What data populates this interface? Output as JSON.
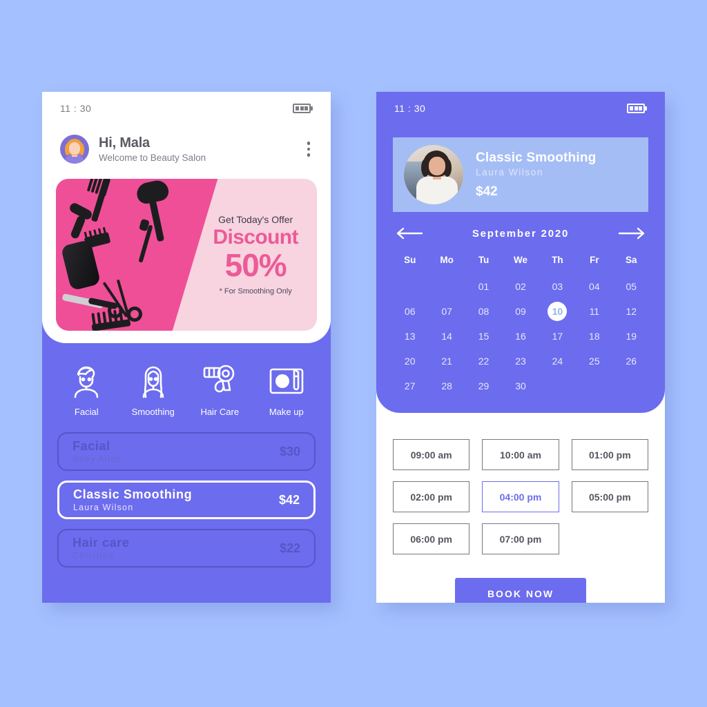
{
  "page": {
    "background_color": "#a5c0fe",
    "accent_purple": "#6c6cee",
    "accent_pink": "#ec5a97",
    "card_blue": "#a5bdf5"
  },
  "left_phone": {
    "status_bar": {
      "time": "11 : 30",
      "signal_icon": "signal-bars-icon",
      "battery_icon": "battery-icon"
    },
    "header": {
      "avatar_icon": "user-avatar-icon",
      "greeting": "Hi, Mala",
      "subtitle": "Welcome to Beauty Salon",
      "menu_icon": "kebab-menu-icon"
    },
    "banner": {
      "offer_label": "Get Today's Offer",
      "discount_word": "Discount",
      "discount_value": "50%",
      "note": "* For Smoothing Only"
    },
    "categories": [
      {
        "label": "Facial",
        "icon": "facial-icon"
      },
      {
        "label": "Smoothing",
        "icon": "smoothing-icon"
      },
      {
        "label": "Hair Care",
        "icon": "hair-dryer-icon"
      },
      {
        "label": "Make up",
        "icon": "makeup-icon"
      }
    ],
    "services": [
      {
        "name": "Facial",
        "stylist": "Bney Alian",
        "price": "$30",
        "selected": false
      },
      {
        "name": "Classic Smoothing",
        "stylist": "Laura Wilson",
        "price": "$42",
        "selected": true
      },
      {
        "name": "Hair care",
        "stylist": "Christina",
        "price": "$22",
        "selected": false
      }
    ]
  },
  "right_phone": {
    "status_bar": {
      "time": "11 : 30",
      "signal_icon": "signal-bars-icon",
      "battery_icon": "battery-icon"
    },
    "service_card": {
      "photo_icon": "stylist-photo",
      "title": "Classic Smoothing",
      "stylist": "Laura Wilson",
      "price": "$42"
    },
    "calendar": {
      "prev_icon": "arrow-left-icon",
      "next_icon": "arrow-right-icon",
      "month_label": "September 2020",
      "weekdays": [
        "Su",
        "Mo",
        "Tu",
        "We",
        "Th",
        "Fr",
        "Sa"
      ],
      "leading_blanks": 2,
      "days": [
        "01",
        "02",
        "03",
        "04",
        "05",
        "06",
        "07",
        "08",
        "09",
        "10",
        "11",
        "12",
        "13",
        "14",
        "15",
        "16",
        "17",
        "18",
        "19",
        "20",
        "21",
        "22",
        "23",
        "24",
        "25",
        "26",
        "27",
        "28",
        "29",
        "30"
      ],
      "selected_day": "10"
    },
    "time_slots": [
      {
        "label": "09:00 am",
        "selected": false
      },
      {
        "label": "10:00 am",
        "selected": false
      },
      {
        "label": "01:00 pm",
        "selected": false
      },
      {
        "label": "02:00 pm",
        "selected": false
      },
      {
        "label": "04:00 pm",
        "selected": true
      },
      {
        "label": "05:00 pm",
        "selected": false
      },
      {
        "label": "06:00 pm",
        "selected": false
      },
      {
        "label": "07:00 pm",
        "selected": false
      }
    ],
    "book_button": "BOOK NOW"
  }
}
